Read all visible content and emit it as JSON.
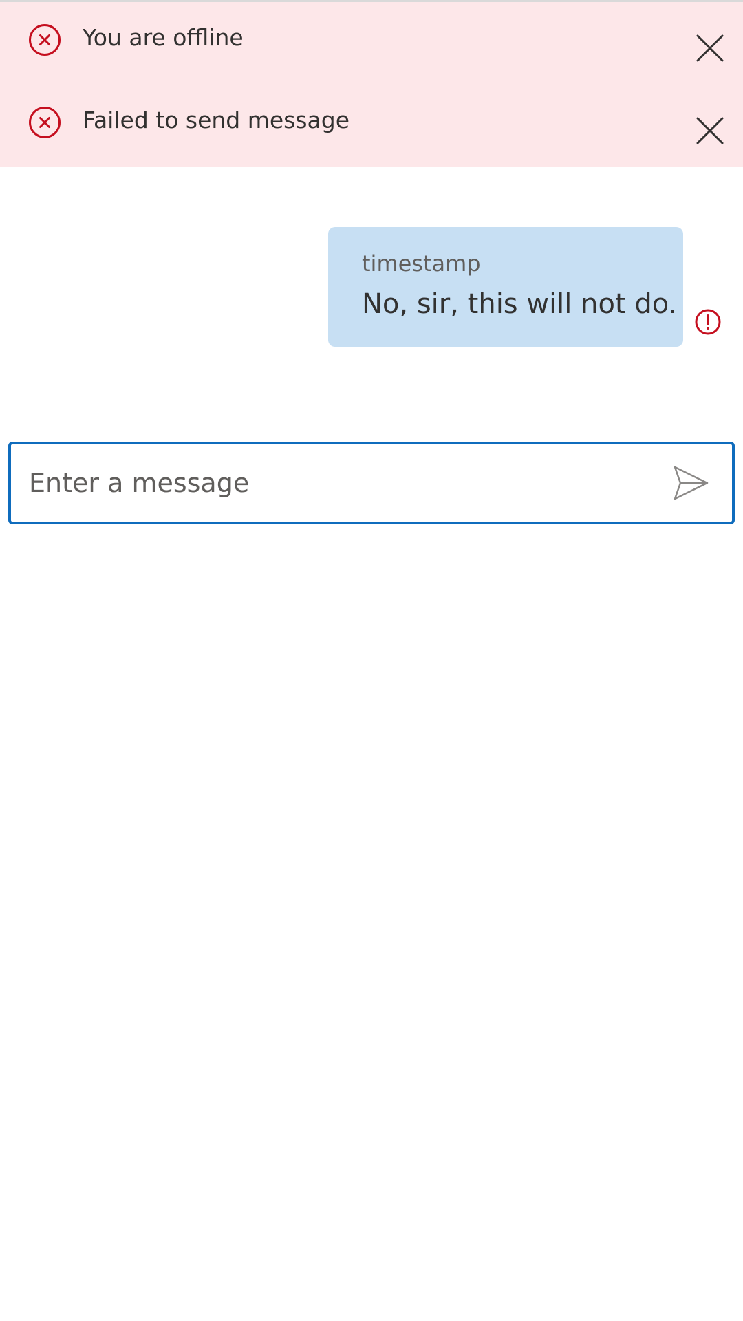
{
  "notifications": [
    {
      "icon": "error-circle-icon",
      "text": "You are offline",
      "dismiss_icon": "close-icon"
    },
    {
      "icon": "error-circle-icon",
      "text": "Failed to send message",
      "dismiss_icon": "close-icon"
    }
  ],
  "messages": [
    {
      "timestamp": "timestamp",
      "text": "No, sir, this will not do.",
      "status_icon": "send-failed-icon"
    }
  ],
  "composer": {
    "placeholder": "Enter a message",
    "value": "",
    "send_icon": "send-icon"
  },
  "colors": {
    "notification_bg": "#fde7e9",
    "error_red": "#c50f1f",
    "bubble_bg": "#c7dff3",
    "focus_border": "#0f6cbd",
    "text": "#323130",
    "secondary_text": "#605e5c"
  }
}
